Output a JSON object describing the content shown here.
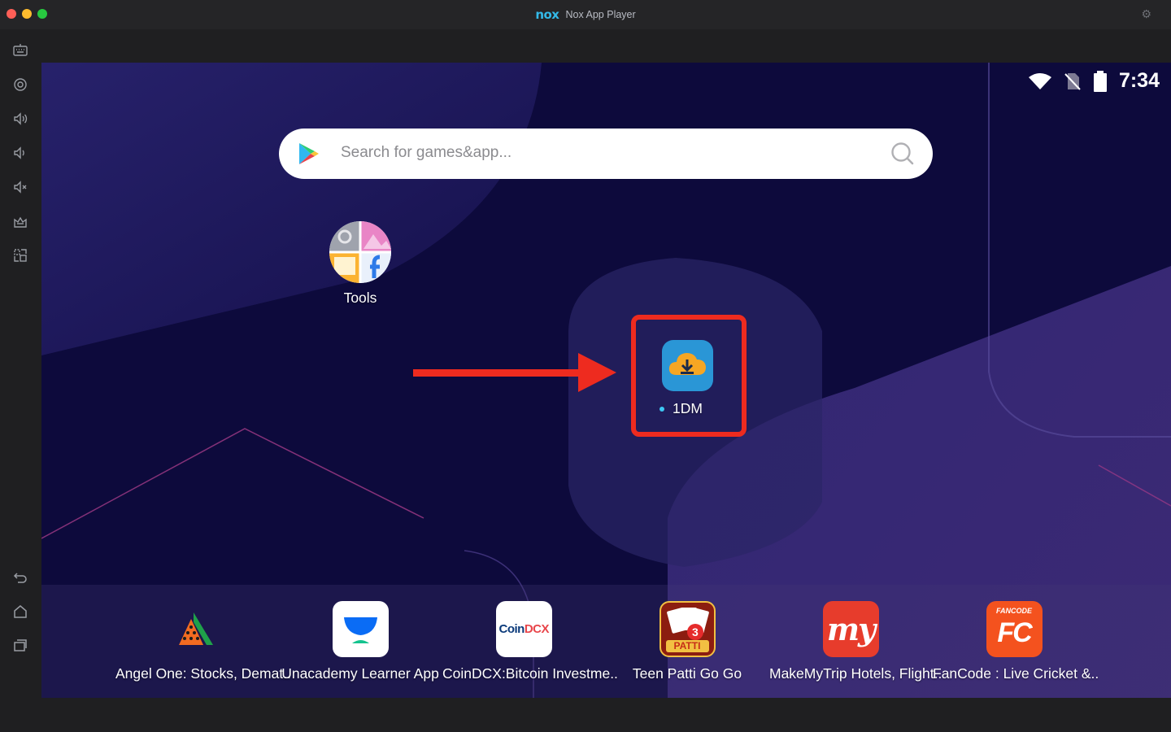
{
  "window": {
    "title": "Nox App Player",
    "logo_text": "nox"
  },
  "sidebar": {
    "items": [
      {
        "name": "keyboard-icon"
      },
      {
        "name": "location-icon"
      },
      {
        "name": "volume-up-icon"
      },
      {
        "name": "volume-down-icon"
      },
      {
        "name": "mute-icon"
      },
      {
        "name": "screenshot-icon"
      },
      {
        "name": "multi-instance-icon"
      },
      {
        "name": "back-icon"
      },
      {
        "name": "home-icon"
      },
      {
        "name": "recent-apps-icon"
      }
    ]
  },
  "status_bar": {
    "time": "7:34"
  },
  "search": {
    "placeholder": "Search for games&app..."
  },
  "desktop": {
    "tools_label": "Tools",
    "highlighted_app_label": "1DM"
  },
  "dock": {
    "apps": [
      {
        "label": "Angel One: Stocks, Demat.."
      },
      {
        "label": "Unacademy Learner App"
      },
      {
        "label": "CoinDCX:Bitcoin Investme.."
      },
      {
        "label": "Teen Patti Go Go"
      },
      {
        "label": "MakeMyTrip Hotels, Flight.."
      },
      {
        "label": "FanCode : Live Cricket &.."
      }
    ],
    "icon_text": {
      "coindcx_a": "Coin",
      "coindcx_b": "DCX",
      "teenpatti": "PATTI",
      "makemytrip": "my",
      "fancode_top": "FANCODE",
      "fancode_main": "FC"
    }
  },
  "colors": {
    "highlight": "#ee2b1f",
    "screen_bg": "#0d0a3c",
    "accent": "#33b9e8"
  }
}
